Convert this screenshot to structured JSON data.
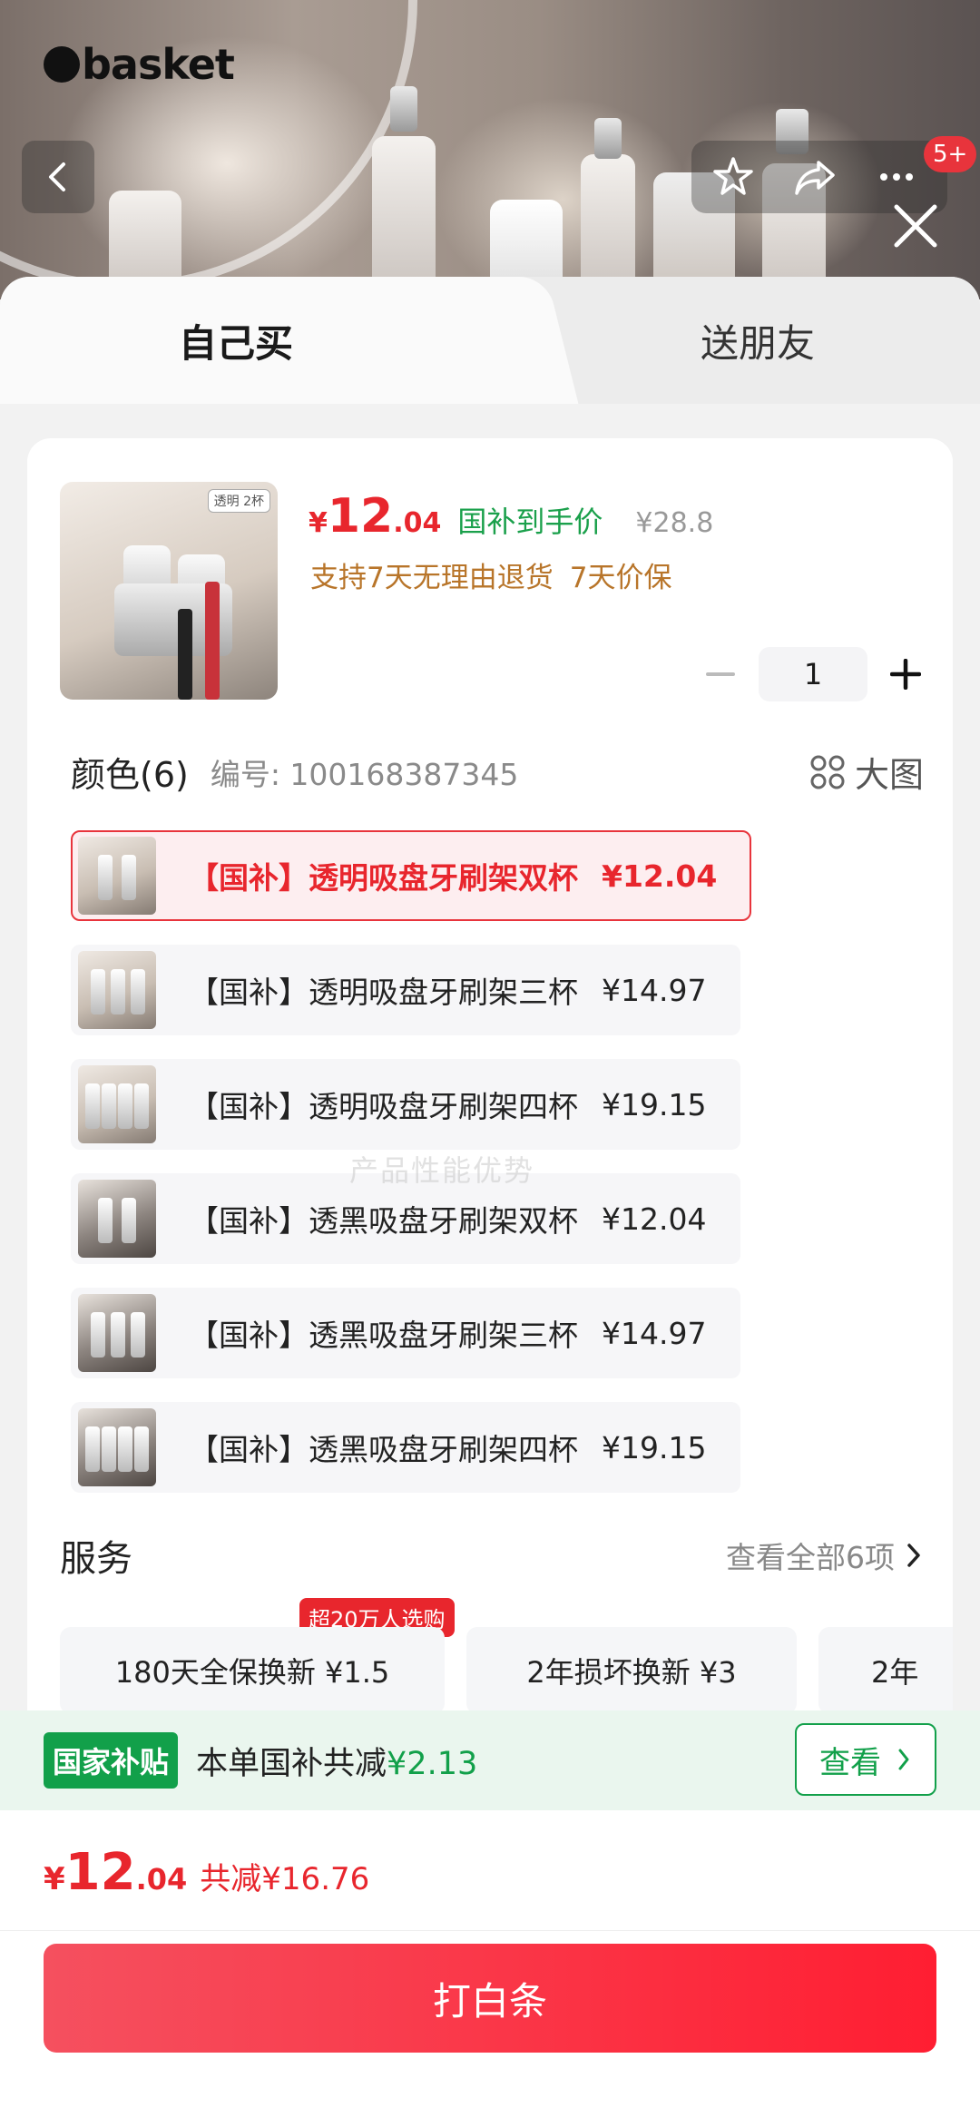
{
  "header": {
    "logo_text": "basket",
    "badge": "5+"
  },
  "tabs": {
    "buy_self": "自己买",
    "gift_friend": "送朋友"
  },
  "product": {
    "thumb_tag": "透明 2杯",
    "price_symbol": "¥",
    "price_int": "12",
    "price_dec": ".04",
    "price_label": "国补到手价",
    "original_price": "¥28.8",
    "promise_1": "支持7天无理由退货",
    "promise_2": "7天价保",
    "quantity": "1"
  },
  "color_section": {
    "title": "颜色(6)",
    "code": "编号: 100168387345",
    "big_view": "大图"
  },
  "options": [
    {
      "label": "【国补】透明吸盘牙刷架双杯",
      "price": "¥12.04",
      "selected": true
    },
    {
      "label": "【国补】透明吸盘牙刷架三杯",
      "price": "¥14.97",
      "selected": false
    },
    {
      "label": "【国补】透明吸盘牙刷架四杯",
      "price": "¥19.15",
      "selected": false
    },
    {
      "label": "【国补】透黑吸盘牙刷架双杯",
      "price": "¥12.04",
      "selected": false
    },
    {
      "label": "【国补】透黑吸盘牙刷架三杯",
      "price": "¥14.97",
      "selected": false
    },
    {
      "label": "【国补】透黑吸盘牙刷架四杯",
      "price": "¥19.15",
      "selected": false
    }
  ],
  "watermark": "产品性能优势",
  "services": {
    "title": "服务",
    "view_all": "查看全部6项",
    "hot_tag": "超20万人选购",
    "items": [
      "180天全保换新  ¥1.5",
      "2年损坏换新  ¥3",
      "2年"
    ]
  },
  "subsidy": {
    "badge": "国家补贴",
    "text": "本单国补共减",
    "amount": "¥2.13",
    "button": "查看"
  },
  "total": {
    "symbol": "¥",
    "int": "12",
    "dec": ".04",
    "save": "共减¥16.76"
  },
  "pay_button": "打白条",
  "colors": {
    "accent_red": "#e8262d",
    "subsidy_green": "#12a04a",
    "promise_brown": "#b8752a"
  }
}
